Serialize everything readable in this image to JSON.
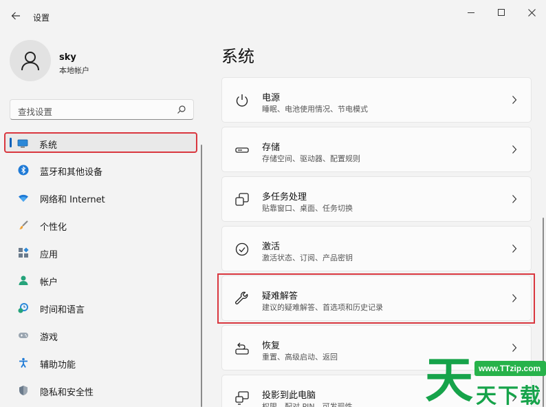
{
  "window": {
    "title": "设置",
    "back_icon": "arrow-left-icon",
    "controls": [
      "minimize-icon",
      "maximize-icon",
      "close-icon"
    ]
  },
  "user": {
    "name": "sky",
    "account_type": "本地帐户"
  },
  "search": {
    "placeholder": "查找设置"
  },
  "sidebar": {
    "items": [
      {
        "label": "系统",
        "icon": "monitor-icon",
        "selected": true
      },
      {
        "label": "蓝牙和其他设备",
        "icon": "bluetooth-icon"
      },
      {
        "label": "网络和 Internet",
        "icon": "wifi-icon"
      },
      {
        "label": "个性化",
        "icon": "brush-icon"
      },
      {
        "label": "应用",
        "icon": "apps-icon"
      },
      {
        "label": "帐户",
        "icon": "person-icon"
      },
      {
        "label": "时间和语言",
        "icon": "clock-globe-icon"
      },
      {
        "label": "游戏",
        "icon": "gamepad-icon"
      },
      {
        "label": "辅助功能",
        "icon": "accessibility-icon"
      },
      {
        "label": "隐私和安全性",
        "icon": "shield-icon"
      }
    ]
  },
  "main": {
    "title": "系统",
    "cards": [
      {
        "title": "电源",
        "subtitle": "睡眠、电池使用情况、节电模式",
        "icon": "power-icon"
      },
      {
        "title": "存储",
        "subtitle": "存储空间、驱动器、配置规则",
        "icon": "storage-icon"
      },
      {
        "title": "多任务处理",
        "subtitle": "贴靠窗口、桌面、任务切换",
        "icon": "multitask-icon"
      },
      {
        "title": "激活",
        "subtitle": "激活状态、订阅、产品密钥",
        "icon": "check-circle-icon"
      },
      {
        "title": "疑难解答",
        "subtitle": "建议的疑难解答、首选项和历史记录",
        "icon": "wrench-icon",
        "highlighted": true
      },
      {
        "title": "恢复",
        "subtitle": "重置、高级启动、返回",
        "icon": "recovery-icon"
      },
      {
        "title": "投影到此电脑",
        "subtitle": "权限、配对 PIN、可发现性",
        "icon": "projection-icon"
      }
    ]
  },
  "watermark": {
    "big_char": "天",
    "small_text": "天下载",
    "url": "www.TTzip.com"
  },
  "colors": {
    "accent": "#005fb8",
    "highlight_border": "#d9363e",
    "watermark_green": "#16a34a"
  }
}
